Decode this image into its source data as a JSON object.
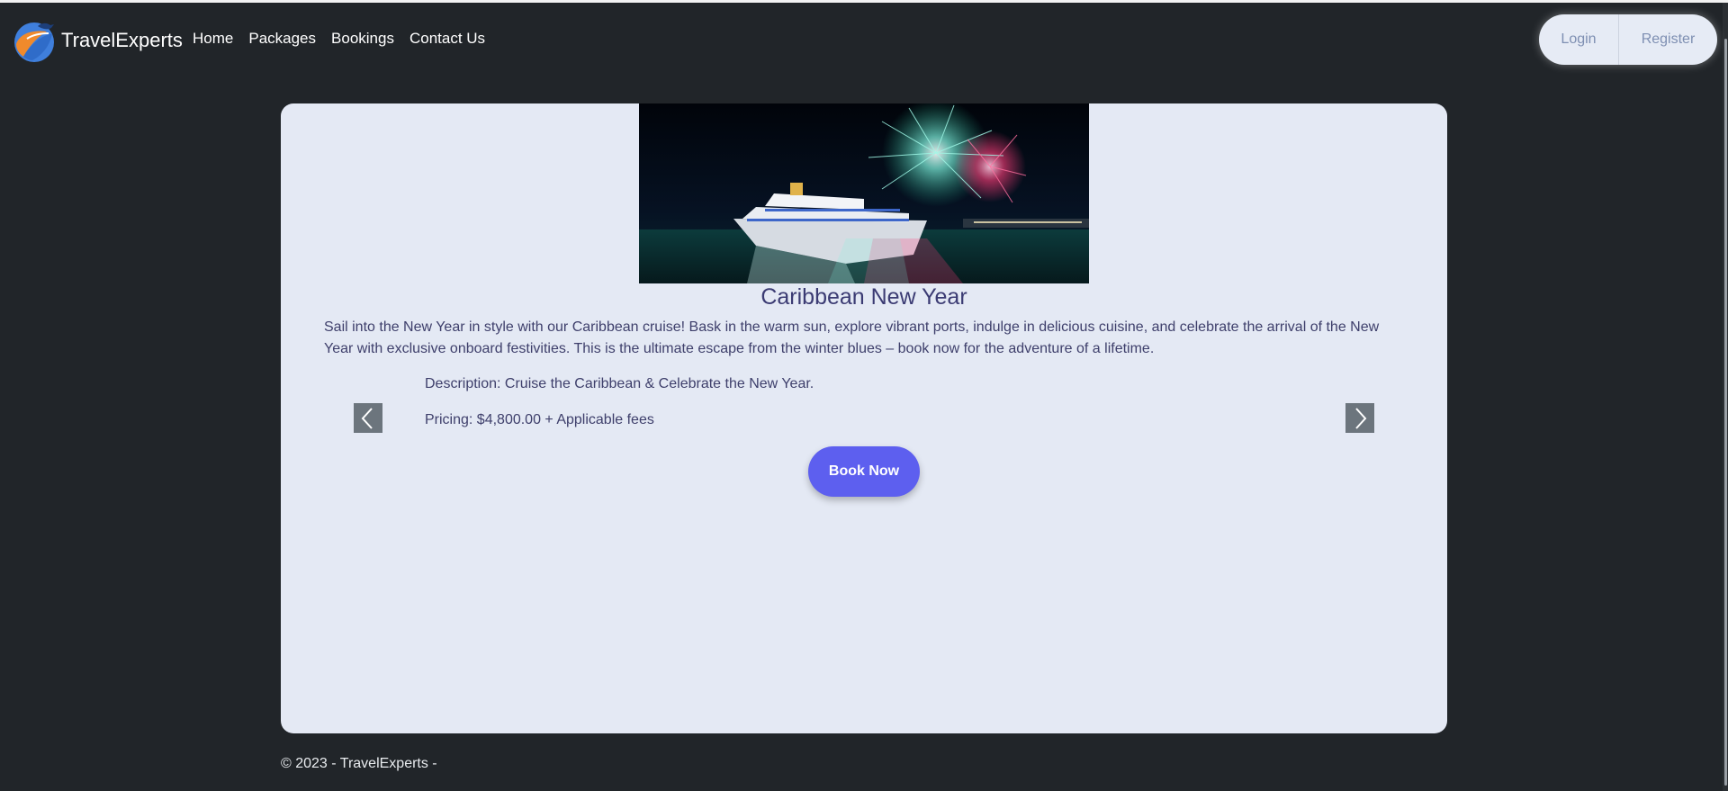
{
  "brand": {
    "name": "TravelExperts",
    "logo_icon": "bird-globe-logo"
  },
  "nav": {
    "items": [
      "Home",
      "Packages",
      "Bookings",
      "Contact Us"
    ]
  },
  "auth": {
    "login_label": "Login",
    "register_label": "Register"
  },
  "package": {
    "title": "Caribbean New Year",
    "long_description": "Sail into the New Year in style with our Caribbean cruise! Bask in the warm sun, explore vibrant ports, indulge in delicious cuisine, and celebrate the arrival of the New Year with exclusive onboard festivities. This is the ultimate escape from the winter blues – book now for the adventure of a lifetime.",
    "description_line": "Description: Cruise the Caribbean & Celebrate the New Year.",
    "pricing_line": "Pricing: $4,800.00 + Applicable fees",
    "image_icon": "cruise-ship-fireworks-image"
  },
  "carousel": {
    "prev_icon": "chevron-left-icon",
    "next_icon": "chevron-right-icon"
  },
  "book_label": "Book Now",
  "footer": {
    "text": "© 2023 - TravelExperts -"
  },
  "colors": {
    "page_bg": "#212529",
    "card_bg": "#e4e9f4",
    "accent": "#5d5fef",
    "heading": "#3b3b73",
    "arrow_bg": "#6c757d"
  }
}
